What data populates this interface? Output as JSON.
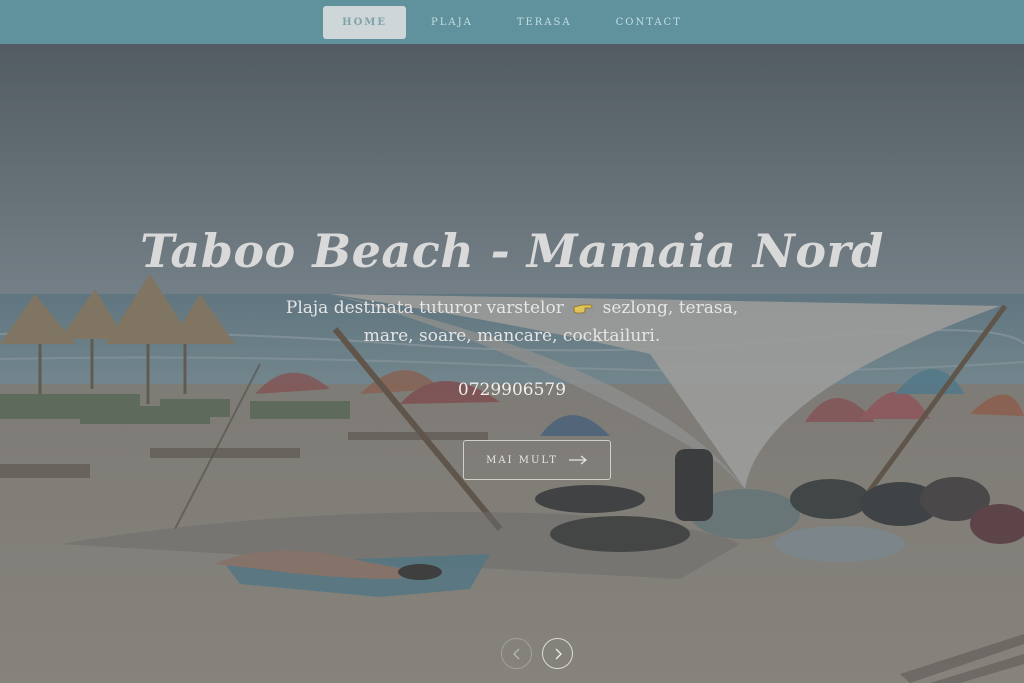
{
  "nav": {
    "items": [
      {
        "label": "HOME",
        "active": true
      },
      {
        "label": "PLAJA",
        "active": false
      },
      {
        "label": "TERASA",
        "active": false
      },
      {
        "label": "CONTACT",
        "active": false
      }
    ]
  },
  "hero": {
    "title": "Taboo Beach - Mamaia Nord",
    "subtitle_part1": "Plaja destinata tuturor varstelor",
    "subtitle_icon": "pointing-hand-icon",
    "subtitle_part2": "sezlong, terasa, mare, soare, mancare, cocktailuri.",
    "phone": "0729906579",
    "more_button": "MAI MULT",
    "more_button_icon": "arrow-right-icon"
  },
  "slider": {
    "prev_icon": "chevron-left-icon",
    "next_icon": "chevron-right-icon"
  },
  "colors": {
    "navbar": "#5f929c",
    "active_tab": "#cfd6d8",
    "overlay": "#464e54"
  }
}
